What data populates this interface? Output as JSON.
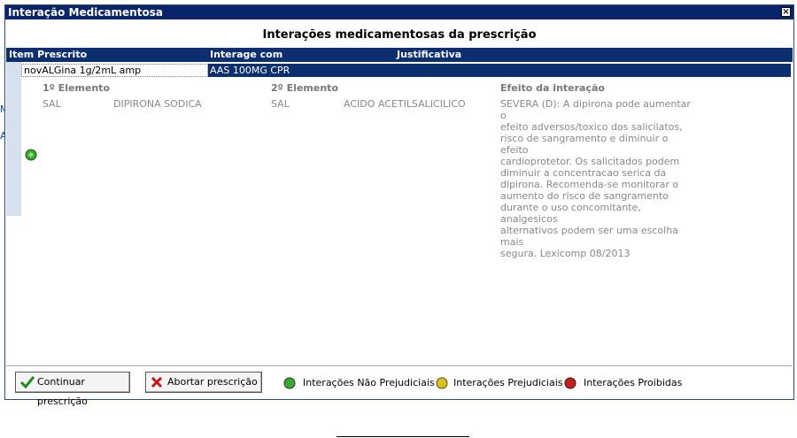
{
  "window": {
    "title": "Interação Medicamentosa",
    "close_glyph": "×"
  },
  "header": {
    "title": "Interações medicamentosas da prescrição"
  },
  "grid": {
    "columns": {
      "item": "Item Prescrito",
      "interage": "Interage com",
      "justificativa": "Justificativa"
    },
    "row": {
      "item": "novALGina 1g/2mL amp",
      "interage": "AAS 100MG CPR",
      "status": "Interações Não Prejudiciais",
      "status_color": "#3aa832"
    },
    "detail": {
      "col1_header": "1º Elemento",
      "col2_header": "2º Elemento",
      "col3_header": "Efeito da interação",
      "el1_type": "SAL",
      "el1_name": "DIPIRONA SODICA",
      "el2_type": "SAL",
      "el2_name": "ACIDO ACETILSALICILICO",
      "effect_lines": [
        "SEVERA (D): A dipirona pode aumentar o",
        "efeito adversos/toxico dos salicilatos,",
        "risco de sangramento e diminuir o efeito",
        "cardioprotetor. Os salicitados podem",
        "diminuir a concentracao serica da",
        "dipirona. Recomenda-se monitorar o",
        "aumento do risco de sangramento",
        "durante o uso concomitante, analgesicos",
        "alternativos podem ser uma escolha mais",
        "segura. Lexicomp 08/2013"
      ]
    }
  },
  "footer": {
    "continue_label": "Continuar prescrição",
    "abort_label": "Abortar prescrição",
    "legend": [
      {
        "label": "Interações Não Prejudiciais",
        "color": "#3aa832"
      },
      {
        "label": "Interações Prejudiciais",
        "color": "#d8c020"
      },
      {
        "label": "Interações Proibidas",
        "color": "#c02020"
      }
    ]
  },
  "background_fragments": [
    "M",
    "A"
  ]
}
